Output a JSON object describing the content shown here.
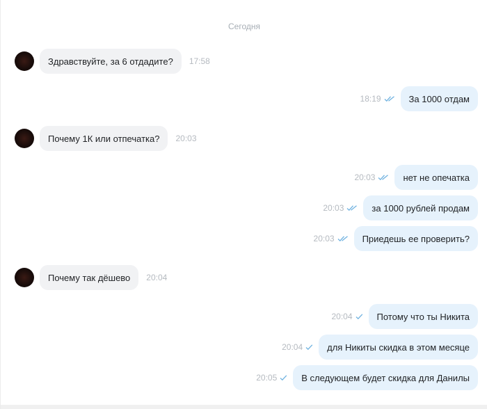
{
  "date_divider": "Сегодня",
  "messages": [
    {
      "text": "Здравствуйте, за 6 отдадите?",
      "time": "17:58"
    },
    {
      "text": "За 1000 отдам",
      "time": "18:19"
    },
    {
      "text": "Почему 1К или отпечатка?",
      "time": "20:03"
    },
    {
      "text": "нет не опечатка",
      "time": "20:03"
    },
    {
      "text": "за 1000 рублей продам",
      "time": "20:03"
    },
    {
      "text": "Приедешь ее проверить?",
      "time": "20:03"
    },
    {
      "text": "Почему так дёшево",
      "time": "20:04"
    },
    {
      "text": "Потому что ты Никита",
      "time": "20:04"
    },
    {
      "text": "для Никиты скидка в этом месяце",
      "time": "20:04"
    },
    {
      "text": "В следующем будет скидка для Данилы",
      "time": "20:05"
    }
  ],
  "icons": {
    "avatar": "user-avatar",
    "read": "double-check-icon",
    "sent": "single-check-icon"
  },
  "colors": {
    "incoming_bubble": "#f1f2f4",
    "outgoing_bubble": "#e6f2fc",
    "check": "#6fb2e0"
  }
}
